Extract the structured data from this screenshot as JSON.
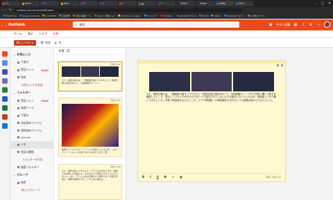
{
  "browser": {
    "tabs": [
      {
        "label": "Ou",
        "color": "#e74c1f",
        "active": false
      },
      {
        "label": "Amaz",
        "color": "#ff9900",
        "active": false
      },
      {
        "label": "Y",
        "color": "#7b1fa2",
        "active": false
      },
      {
        "label": "Ama",
        "color": "#ff9900",
        "active": false
      },
      {
        "label": "Y!",
        "color": "#7b1fa2",
        "active": false
      },
      {
        "label": "Y",
        "color": "#7b1fa2",
        "active": false
      },
      {
        "label": "Y",
        "color": "#d32f2f",
        "active": false
      },
      {
        "label": "拗",
        "color": "#388e3c",
        "active": false
      },
      {
        "label": "Y",
        "color": "#7b1fa2",
        "active": false
      },
      {
        "label": "Steam",
        "color": "#1b2838",
        "active": false
      },
      {
        "label": "Steam",
        "color": "#1b2838",
        "active": false
      },
      {
        "label": "Outlo",
        "color": "#0078d4",
        "active": true
      },
      {
        "label": "Micro",
        "color": "#0078d4",
        "active": false
      }
    ],
    "url": "outlook.live.com/mail/0/notes",
    "bookmarks": [
      {
        "label": "Brightcove",
        "color": "#2962ff"
      },
      {
        "label": "Google calendar",
        "color": "#1a73e8"
      },
      {
        "label": "ScratchMit",
        "color": "#f57c00"
      },
      {
        "label": "引用法規",
        "color": "#43a047"
      },
      {
        "label": "引用•転載ルール",
        "color": "#e53935"
      },
      {
        "label": "Gmail - 受信トレイ",
        "color": "#d93025"
      },
      {
        "label": "My Drive - Google...",
        "color": "#fbbc04"
      },
      {
        "label": "ツイッター",
        "color": "#1da1f2"
      },
      {
        "label": "YouTube",
        "color": "#ff0000"
      },
      {
        "label": "PlayStation®Store",
        "color": "#003791"
      },
      {
        "label": "Twitch",
        "color": "#9146ff"
      },
      {
        "label": "Twitter",
        "color": "#1da1f2"
      },
      {
        "label": "Facebookプロフィ",
        "color": "#1877f2"
      },
      {
        "label": "その他のブック",
        "color": "#888888"
      }
    ]
  },
  "header": {
    "brand": "Outlook",
    "search_placeholder": "検索",
    "meet_now": "今すぐ会議"
  },
  "ribbon": {
    "tabs": [
      "ホーム",
      "表示",
      "ヘルプ",
      "メモ"
    ],
    "active_tab": "メモ",
    "new_note": "新しいメモ",
    "delete": "削除",
    "color": "色"
  },
  "folders": {
    "favorites_title": "お気に入り",
    "favorites": [
      {
        "label": "下書き",
        "count": ""
      },
      {
        "label": "受信トレイ",
        "count": "2042"
      },
      {
        "label": "貼附",
        "count": ""
      }
    ],
    "add_favorite": "お気に入りを追加",
    "folders_title": "フォルダー",
    "items": [
      {
        "label": "受信トレイ",
        "count": "2042"
      },
      {
        "label": "迷惑メール",
        "count": ""
      },
      {
        "label": "下書き",
        "count": ""
      },
      {
        "label": "送信済みアイテム",
        "count": ""
      },
      {
        "label": "削除済みアイテム",
        "count": ""
      },
      {
        "label": "Archive",
        "count": ""
      },
      {
        "label": "メモ",
        "count": "",
        "selected": true
      },
      {
        "label": "会話の履歴",
        "count": ""
      }
    ],
    "new_folder": "フォルダーを作成",
    "search_folder": "検索フォルダー",
    "groups_title": "グループ",
    "groups": [
      {
        "label": "貼附"
      }
    ],
    "new_group": "新しいグループ"
  },
  "list": {
    "title": "メモ",
    "notes": [
      {
        "timestamp": "午後 4:23",
        "body": "ただ、模座の魅力は、一階機能が運びつつやたらと一度用を飲む場合があって、今回他機のいートバ..."
      },
      {
        "timestamp": "午後 4:20",
        "body": "画像ファイルのコピーペーストに対応しているため、このスクリーンショットを貼り付けるも使えてます。便..."
      },
      {
        "timestamp": "午後 4:18",
        "body": "ただ、操作は同じですなんて。チラシの方が出します。他機でも作成した場合にも、元の大きさで保存できるようになりました。また、モバイル版も同期されて便利です。年度の定稿も、所属の検索ができ、メモと共に書込み..."
      }
    ]
  },
  "editor": {
    "text": "ただ、模座の魅力は、一階機能が運びつつやたらと一度用を飲む場合があって、今回他機のノートPCで同時に開いて動きを確認したところ、表示していたメモがPCのうちの一つで保存されていないような動作になっていたため、再起動してから開いてみたところ、手動で再高読み込んだところ、アプリ再起動、OS再起動などを行なっても結果は変わりもせんでした。",
    "format": [
      "B",
      "I",
      "U",
      "S",
      "≡",
      "▣"
    ],
    "saved": "保存: 午後 4:23"
  }
}
